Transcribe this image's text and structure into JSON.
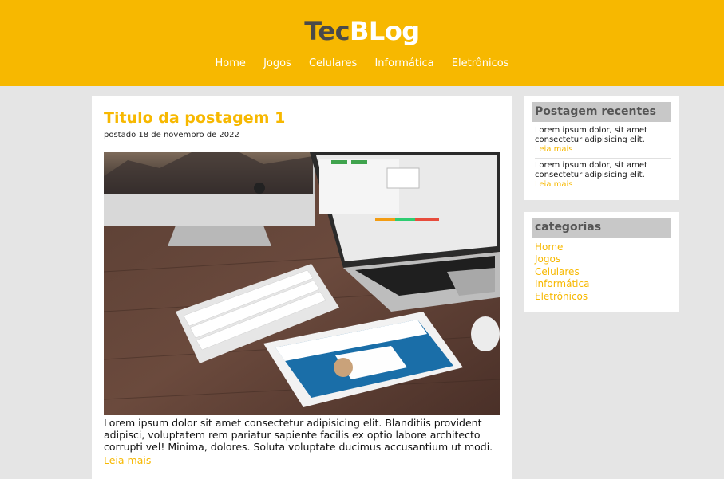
{
  "header": {
    "logo_part1": "Tec",
    "logo_part2": "BLog",
    "nav": [
      "Home",
      "Jogos",
      "Celulares",
      "Informática",
      "Eletrônicos"
    ]
  },
  "post": {
    "title": "Titulo da postagem 1",
    "date": "postado 18 de novembro de 2022",
    "text": "Lorem ipsum dolor sit amet consectetur adipisicing elit. Blanditiis provident adipisci, voluptatem rem pariatur sapiente facilis ex optio labore architecto corrupti vel! Minima, dolores. Soluta voluptate ducimus accusantium ut modi.",
    "read_more": "Leia mais"
  },
  "sidebar": {
    "recent_title": "Postagem recentes",
    "recent": [
      {
        "text": "Lorem ipsum dolor, sit amet consectetur adipisicing elit.",
        "more": "Leia mais"
      },
      {
        "text": "Lorem ipsum dolor, sit amet consectetur adipisicing elit.",
        "more": "Leia mais"
      }
    ],
    "categories_title": "categorias",
    "categories": [
      "Home",
      "Jogos",
      "Celulares",
      "Informática",
      "Eletrônicos"
    ]
  },
  "colors": {
    "accent": "#f7b800",
    "background": "#e5e5e5",
    "widget_title_bg": "#c8c8c8"
  }
}
